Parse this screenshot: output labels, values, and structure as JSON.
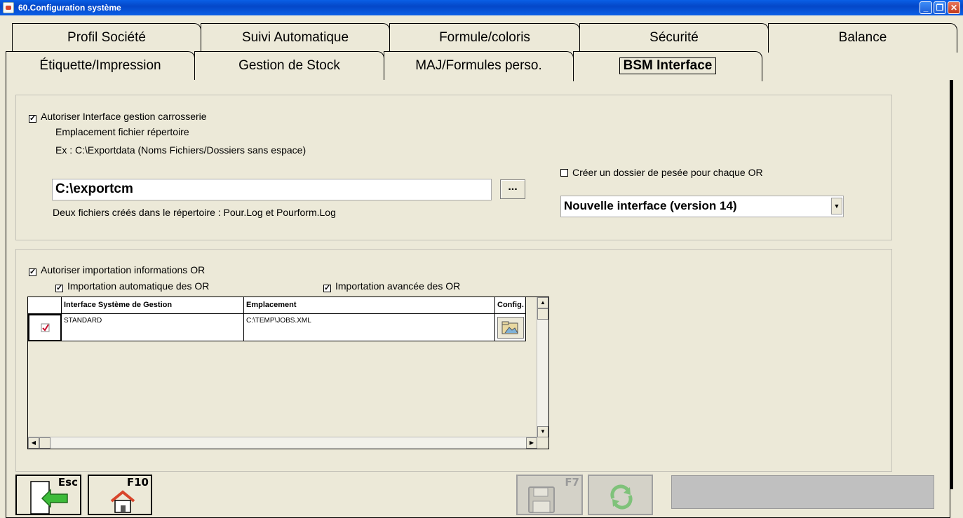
{
  "window": {
    "title": "60.Configuration système",
    "minimize": "_",
    "restore": "❐",
    "close": "✕"
  },
  "tabs_row1": [
    "Profil Société",
    "Suivi Automatique",
    "Formule/coloris",
    "Sécurité",
    "Balance"
  ],
  "tabs_row2": [
    "Étiquette/Impression",
    "Gestion de Stock",
    "MAJ/Formules perso.",
    "BSM Interface"
  ],
  "active_tab": "BSM Interface",
  "section1": {
    "allow_label": "Autoriser Interface gestion carrosserie",
    "allow_checked": true,
    "location_label": "Emplacement fichier répertoire",
    "example": "Ex : C:\\Exportdata (Noms Fichiers/Dossiers sans espace)",
    "path_value": "C:\\exportcm",
    "browse_label": "...",
    "note": "Deux fichiers créés dans le répertoire : Pour.Log et Pourform.Log",
    "create_folder_label": "Créer un dossier de pesée pour chaque OR",
    "create_folder_checked": false,
    "interface_version": "Nouvelle interface (version 14)"
  },
  "section2": {
    "allow_import_label": "Autoriser importation informations OR",
    "allow_import_checked": true,
    "auto_import_label": "Importation automatique des OR",
    "auto_import_checked": true,
    "advanced_import_label": "Importation avancée des OR",
    "advanced_import_checked": true,
    "table": {
      "headers": [
        "Interface Système de Gestion",
        "Emplacement",
        "Config."
      ],
      "rows": [
        {
          "checked": true,
          "system": "STANDARD",
          "location": "C:\\TEMP\\JOBS.XML"
        }
      ]
    }
  },
  "toolbar": {
    "esc_key": "Esc",
    "f10_key": "F10",
    "f7_key": "F7"
  },
  "colors": {
    "window_bg": "#ece9d8",
    "titlebar": "#0447c8",
    "exit_arrow": "#3dbb3a",
    "home_roof": "#d8452b"
  }
}
